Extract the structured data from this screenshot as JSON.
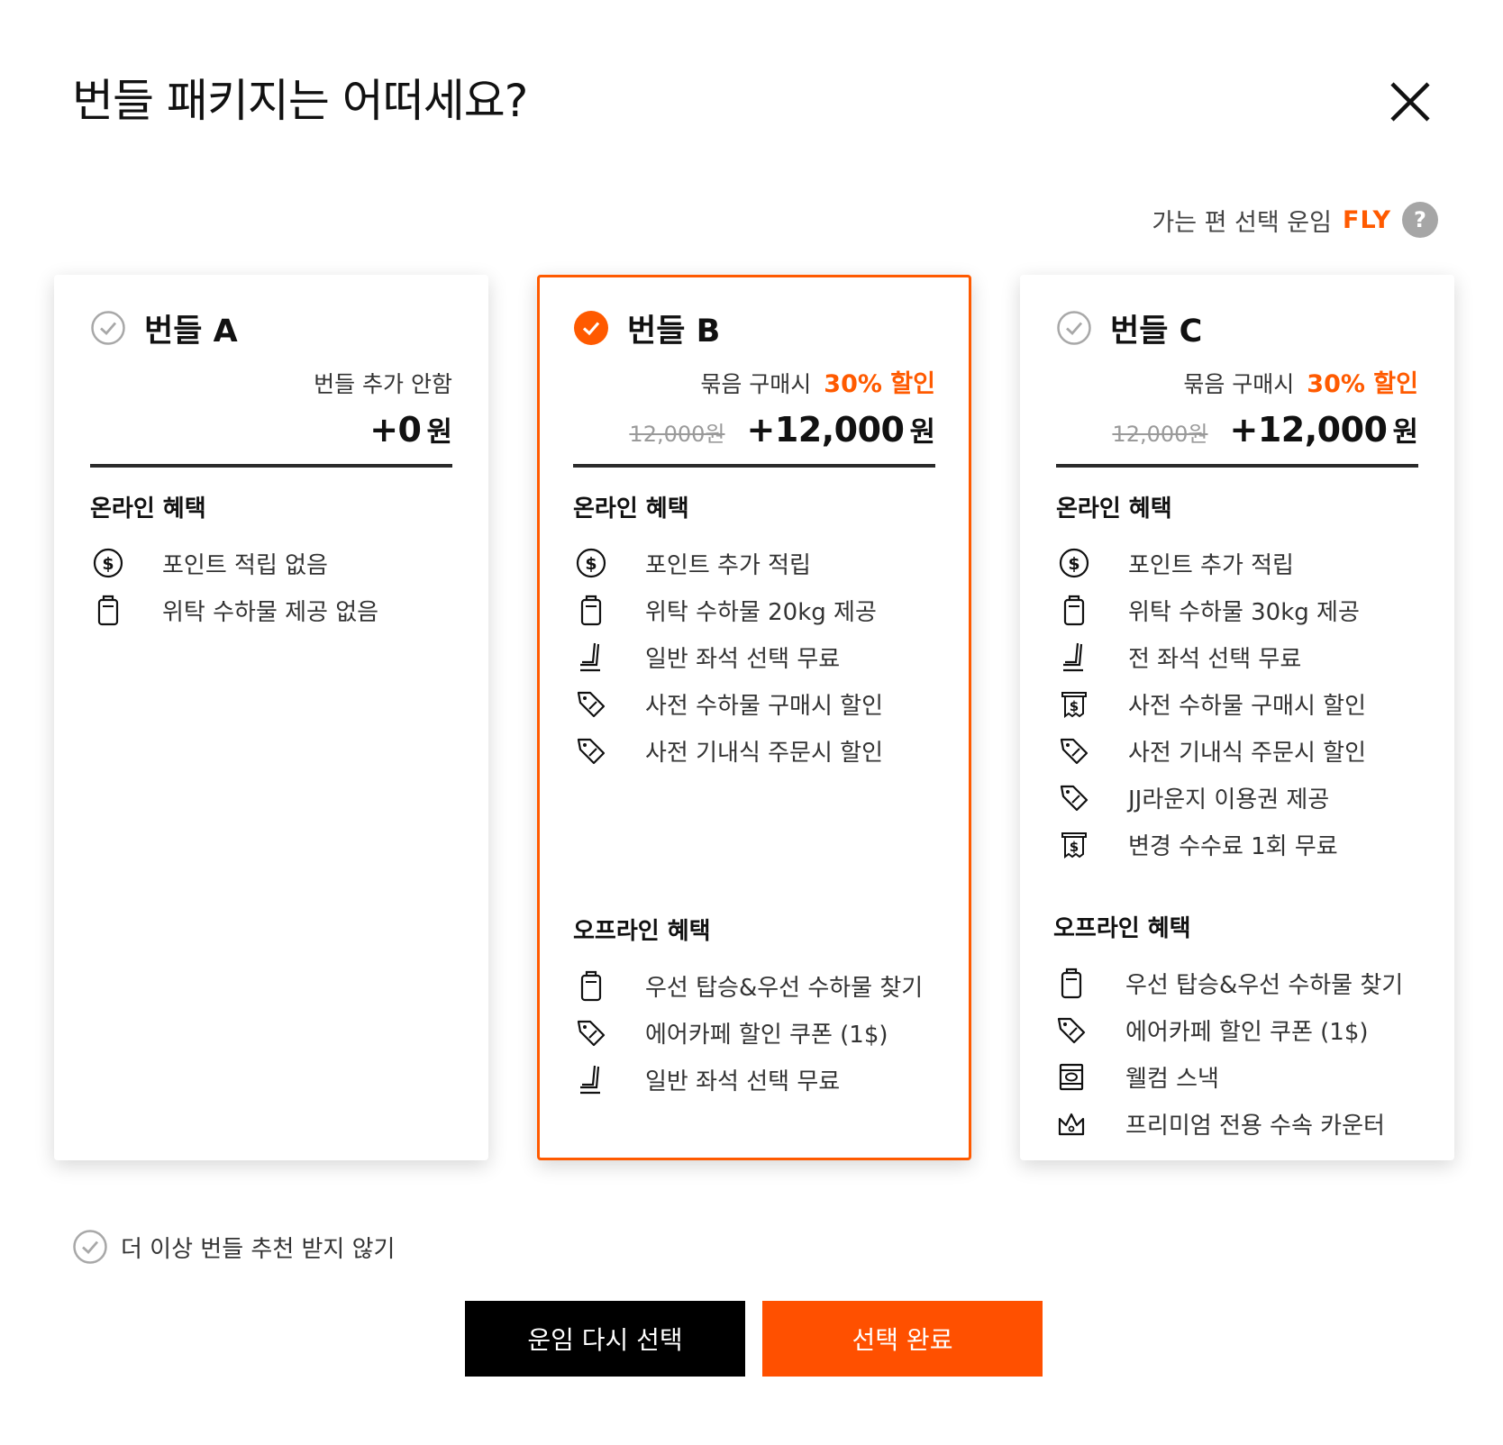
{
  "header": {
    "title": "번들 패키지는 어떠세요?",
    "close_icon": "close-icon"
  },
  "fare": {
    "label": "가는 편 선택 운임",
    "value": "FLY",
    "help_icon": "?"
  },
  "colors": {
    "accent": "#ff5a00",
    "dark_button": "#000000",
    "muted": "#9a9a9a"
  },
  "cards": [
    {
      "name": "번들 A",
      "selected": false,
      "note": "번들 추가 안함",
      "discount": "",
      "original_price": "",
      "price": "+0",
      "won": "원",
      "online_title": "온라인 혜택",
      "online": [
        {
          "icon": "dollar-icon",
          "text": "포인트 적립 없음"
        },
        {
          "icon": "luggage-icon",
          "text": "위탁 수하물 제공 없음"
        }
      ]
    },
    {
      "name": "번들 B",
      "selected": true,
      "note": "묶음 구매시",
      "discount": "30% 할인",
      "original_price": "12,000원",
      "price": "+12,000",
      "won": "원",
      "online_title": "온라인 혜택",
      "online": [
        {
          "icon": "dollar-icon",
          "text": "포인트 추가 적립"
        },
        {
          "icon": "luggage-icon",
          "text": "위탁 수하물 20kg 제공"
        },
        {
          "icon": "seat-icon",
          "text": "일반 좌석 선택 무료"
        },
        {
          "icon": "tag-icon",
          "text": "사전 수하물 구매시 할인"
        },
        {
          "icon": "tag-icon",
          "text": "사전 기내식 주문시 할인"
        }
      ],
      "offline_title": "오프라인 혜택",
      "offline": [
        {
          "icon": "luggage-icon",
          "text": "우선 탑승&우선 수하물 찾기"
        },
        {
          "icon": "tag-icon",
          "text": "에어카페 할인 쿠폰 (1$)"
        },
        {
          "icon": "seat-icon",
          "text": "일반 좌석 선택 무료"
        }
      ]
    },
    {
      "name": "번들 C",
      "selected": false,
      "note": "묶음 구매시",
      "discount": "30% 할인",
      "original_price": "12,000원",
      "price": "+12,000",
      "won": "원",
      "online_title": "온라인 혜택",
      "online": [
        {
          "icon": "dollar-icon",
          "text": "포인트 추가 적립"
        },
        {
          "icon": "luggage-icon",
          "text": "위탁 수하물 30kg 제공"
        },
        {
          "icon": "seat-icon",
          "text": "전 좌석 선택 무료"
        },
        {
          "icon": "receipt-icon",
          "text": "사전 수하물 구매시 할인"
        },
        {
          "icon": "tag-icon",
          "text": "사전 기내식 주문시 할인"
        },
        {
          "icon": "tag-icon",
          "text": "JJ라운지 이용권 제공"
        },
        {
          "icon": "receipt-icon",
          "text": "변경 수수료 1회 무료"
        }
      ],
      "offline_title": "오프라인 혜택",
      "offline": [
        {
          "icon": "luggage-icon",
          "text": "우선 탑승&우선 수하물 찾기"
        },
        {
          "icon": "tag-icon",
          "text": "에어카페 할인 쿠폰 (1$)"
        },
        {
          "icon": "snack-icon",
          "text": "웰컴 스낵"
        },
        {
          "icon": "crown-icon",
          "text": "프리미엄 전용 수속 카운터"
        }
      ]
    }
  ],
  "footer": {
    "no_recommend": "더 이상 번들 추천 받지 않기",
    "reselect_button": "운임 다시 선택",
    "done_button": "선택 완료"
  }
}
